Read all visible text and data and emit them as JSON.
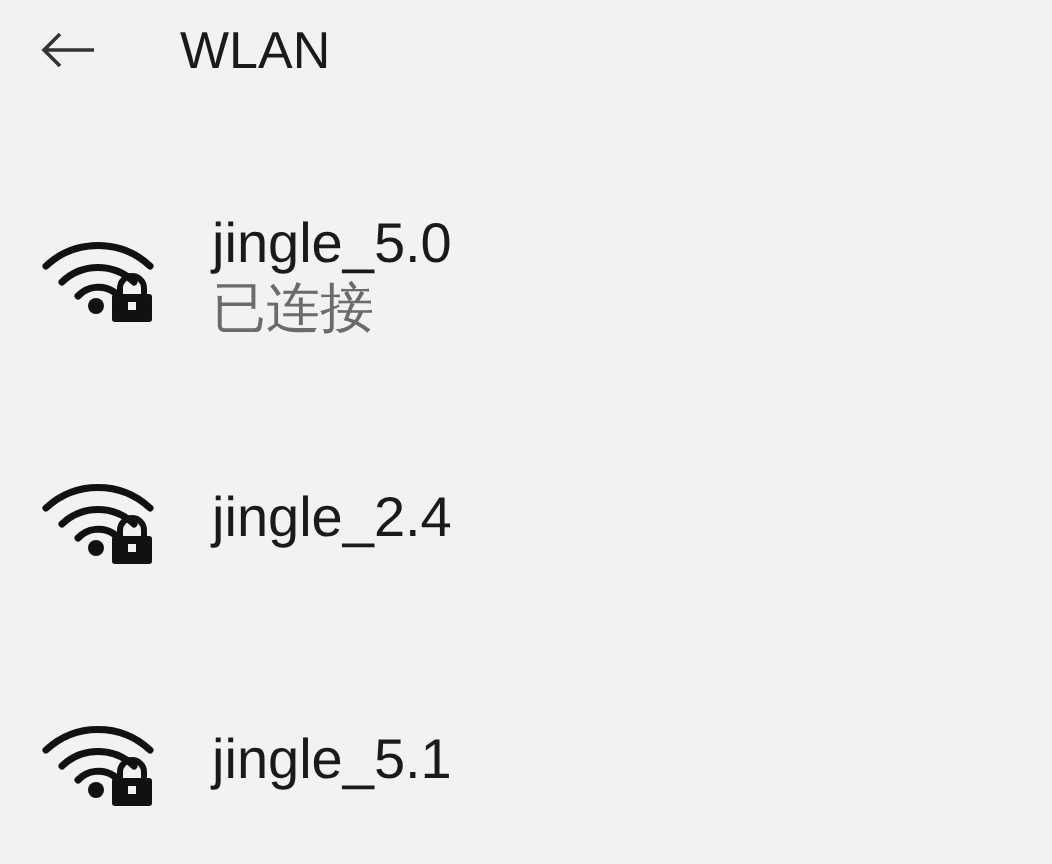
{
  "header": {
    "title": "WLAN"
  },
  "networks": [
    {
      "name": "jingle_5.0",
      "status": "已连接"
    },
    {
      "name": "jingle_2.4"
    },
    {
      "name": "jingle_5.1"
    }
  ]
}
